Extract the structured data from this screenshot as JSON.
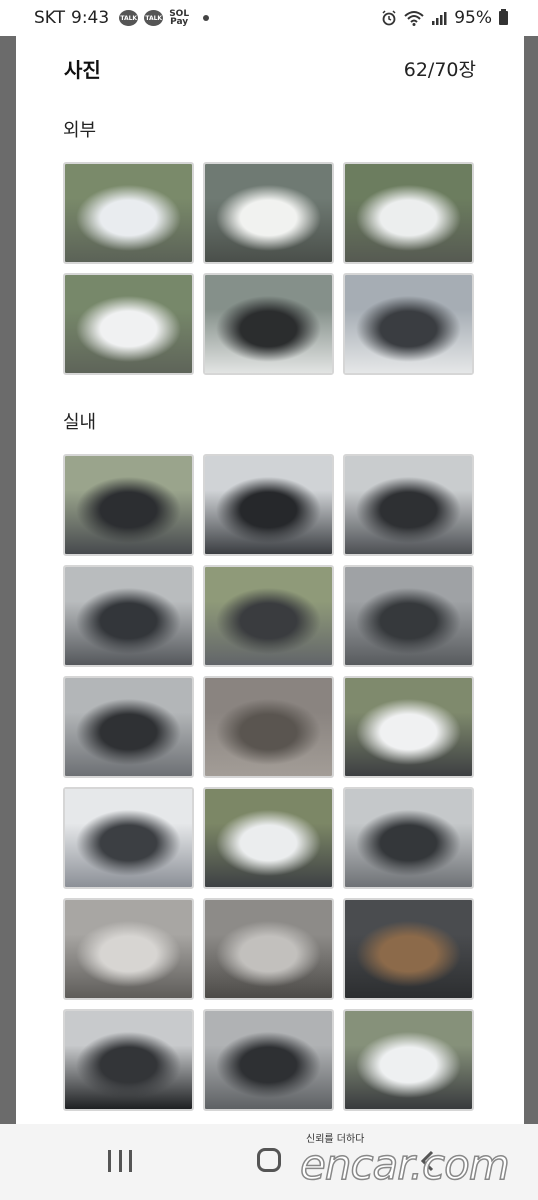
{
  "status_bar": {
    "carrier": "SKT",
    "time": "9:43",
    "talk_badge_1": "TALK",
    "talk_badge_2": "TALK",
    "pay_badge": "Sol Pay",
    "battery": "95%"
  },
  "header": {
    "title": "사진",
    "photo_count": "62/70장"
  },
  "sections": {
    "exterior": {
      "label": "외부",
      "photos": [
        {
          "name": "exterior-photo-front-left",
          "tone": [
            "#7a8a6a",
            "#e9ecef",
            "#5b6257"
          ]
        },
        {
          "name": "exterior-photo-rear",
          "tone": [
            "#6f7a73",
            "#f1f2f0",
            "#4a4f4a"
          ]
        },
        {
          "name": "exterior-photo-rear-right",
          "tone": [
            "#6c7d5f",
            "#eceeee",
            "#565a52"
          ]
        },
        {
          "name": "exterior-photo-side",
          "tone": [
            "#77886a",
            "#f0f1f2",
            "#5e6459"
          ]
        },
        {
          "name": "exterior-photo-engine-bay",
          "tone": [
            "#85908a",
            "#2b2d2e",
            "#e2e4e3"
          ]
        },
        {
          "name": "exterior-photo-trunk-open",
          "tone": [
            "#a6adb4",
            "#3a3d41",
            "#e5e7e8"
          ]
        }
      ]
    },
    "interior": {
      "label": "실내",
      "photos": [
        {
          "name": "interior-photo-cluster",
          "tone": [
            "#9aa48c",
            "#2c2e31",
            "#474a4e"
          ]
        },
        {
          "name": "interior-photo-steering-wheel",
          "tone": [
            "#d0d3d6",
            "#26282b",
            "#3b3e42"
          ]
        },
        {
          "name": "interior-photo-dashboard-gauges",
          "tone": [
            "#c9ccce",
            "#2e3033",
            "#4d5054"
          ]
        },
        {
          "name": "interior-photo-dash-left",
          "tone": [
            "#b9bcbe",
            "#33363a",
            "#55585c"
          ]
        },
        {
          "name": "interior-photo-door-panel",
          "tone": [
            "#8f9a79",
            "#3a3c3f",
            "#626569"
          ]
        },
        {
          "name": "interior-photo-center-console",
          "tone": [
            "#9fa2a5",
            "#36393c",
            "#585b5e"
          ]
        },
        {
          "name": "interior-photo-center-stack",
          "tone": [
            "#b3b6b8",
            "#2f3134",
            "#6d7074"
          ]
        },
        {
          "name": "interior-photo-headliner-lamp",
          "tone": [
            "#8a8480",
            "#5a5550",
            "#a39d97"
          ]
        },
        {
          "name": "interior-photo-front-door-open",
          "tone": [
            "#7f8a6d",
            "#f0f1f2",
            "#3d3f42"
          ]
        },
        {
          "name": "interior-photo-rear-door-open",
          "tone": [
            "#e6e8ea",
            "#3c3f43",
            "#8c9097"
          ]
        },
        {
          "name": "interior-photo-both-doors-open",
          "tone": [
            "#7c8766",
            "#ebedee",
            "#3e4144"
          ]
        },
        {
          "name": "interior-photo-rear-cabin",
          "tone": [
            "#c5c8ca",
            "#34373a",
            "#6f7276"
          ]
        },
        {
          "name": "interior-photo-headliner",
          "tone": [
            "#a8a6a3",
            "#d7d5d2",
            "#5e5c59"
          ]
        },
        {
          "name": "interior-photo-roof-light",
          "tone": [
            "#8d8b88",
            "#c2c0bd",
            "#4d4b48"
          ]
        },
        {
          "name": "interior-photo-cargo-rack",
          "tone": [
            "#4a4c4f",
            "#8c6a4a",
            "#2c2e30"
          ]
        },
        {
          "name": "interior-photo-rear-window",
          "tone": [
            "#c8cacc",
            "#333538",
            "#1e2022"
          ]
        },
        {
          "name": "interior-photo-rear-door-panel",
          "tone": [
            "#b0b2b4",
            "#2e3033",
            "#5e6164"
          ]
        },
        {
          "name": "interior-photo-front-door-panel",
          "tone": [
            "#86917a",
            "#eef0f1",
            "#393b3e"
          ]
        }
      ]
    }
  },
  "navigation": {
    "recent_label": "recent-apps",
    "home_label": "home",
    "back_label": "back"
  },
  "watermark": {
    "tagline": "신뢰를 더하다",
    "logo": "encar.com"
  }
}
